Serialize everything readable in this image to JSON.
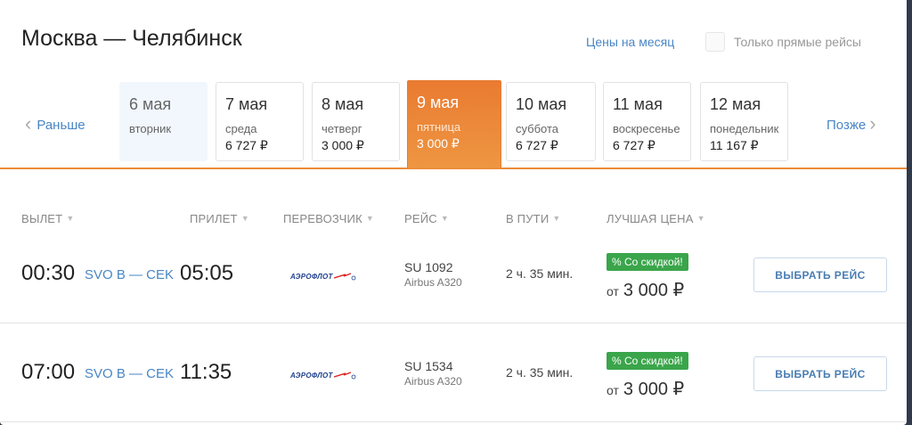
{
  "header": {
    "title": "Москва — Челябинск",
    "month_link": "Цены на месяц",
    "direct_only": "Только прямые рейсы"
  },
  "dates": {
    "prev_label": "Раньше",
    "next_label": "Позже",
    "days": [
      {
        "date": "6 мая",
        "weekday": "вторник",
        "price": ""
      },
      {
        "date": "7 мая",
        "weekday": "среда",
        "price": "6 727 ₽"
      },
      {
        "date": "8 мая",
        "weekday": "четверг",
        "price": "3 000 ₽"
      },
      {
        "date": "9 мая",
        "weekday": "пятница",
        "price": "3 000 ₽"
      },
      {
        "date": "10 мая",
        "weekday": "суббота",
        "price": "6 727 ₽"
      },
      {
        "date": "11 мая",
        "weekday": "воскресенье",
        "price": "6 727 ₽"
      },
      {
        "date": "12 мая",
        "weekday": "понедельник",
        "price": "11 167 ₽"
      }
    ]
  },
  "columns": {
    "departure": "ВЫЛЕТ",
    "arrival": "ПРИЛЕТ",
    "carrier": "ПЕРЕВОЗЧИК",
    "flight": "РЕЙС",
    "duration": "В ПУТИ",
    "best_price": "ЛУЧШАЯ ЦЕНА"
  },
  "flights": [
    {
      "dep_time": "00:30",
      "route": "SVO B — CEK",
      "arr_time": "05:05",
      "airline": "АЭРОФЛОТ",
      "flight_no": "SU 1092",
      "aircraft": "Airbus A320",
      "duration": "2 ч. 35 мин.",
      "badge": "% Со скидкой!",
      "price_from": "от",
      "price": "3 000 ₽",
      "button": "ВЫБРАТЬ РЕЙС"
    },
    {
      "dep_time": "07:00",
      "route": "SVO B — CEK",
      "arr_time": "11:35",
      "airline": "АЭРОФЛОТ",
      "flight_no": "SU 1534",
      "aircraft": "Airbus A320",
      "duration": "2 ч. 35 мин.",
      "badge": "% Со скидкой!",
      "price_from": "от",
      "price": "3 000 ₽",
      "button": "ВЫБРАТЬ РЕЙС"
    }
  ],
  "colors": {
    "accent": "#4a86c5",
    "active_day": "#e97b31",
    "discount": "#3aa54a"
  }
}
